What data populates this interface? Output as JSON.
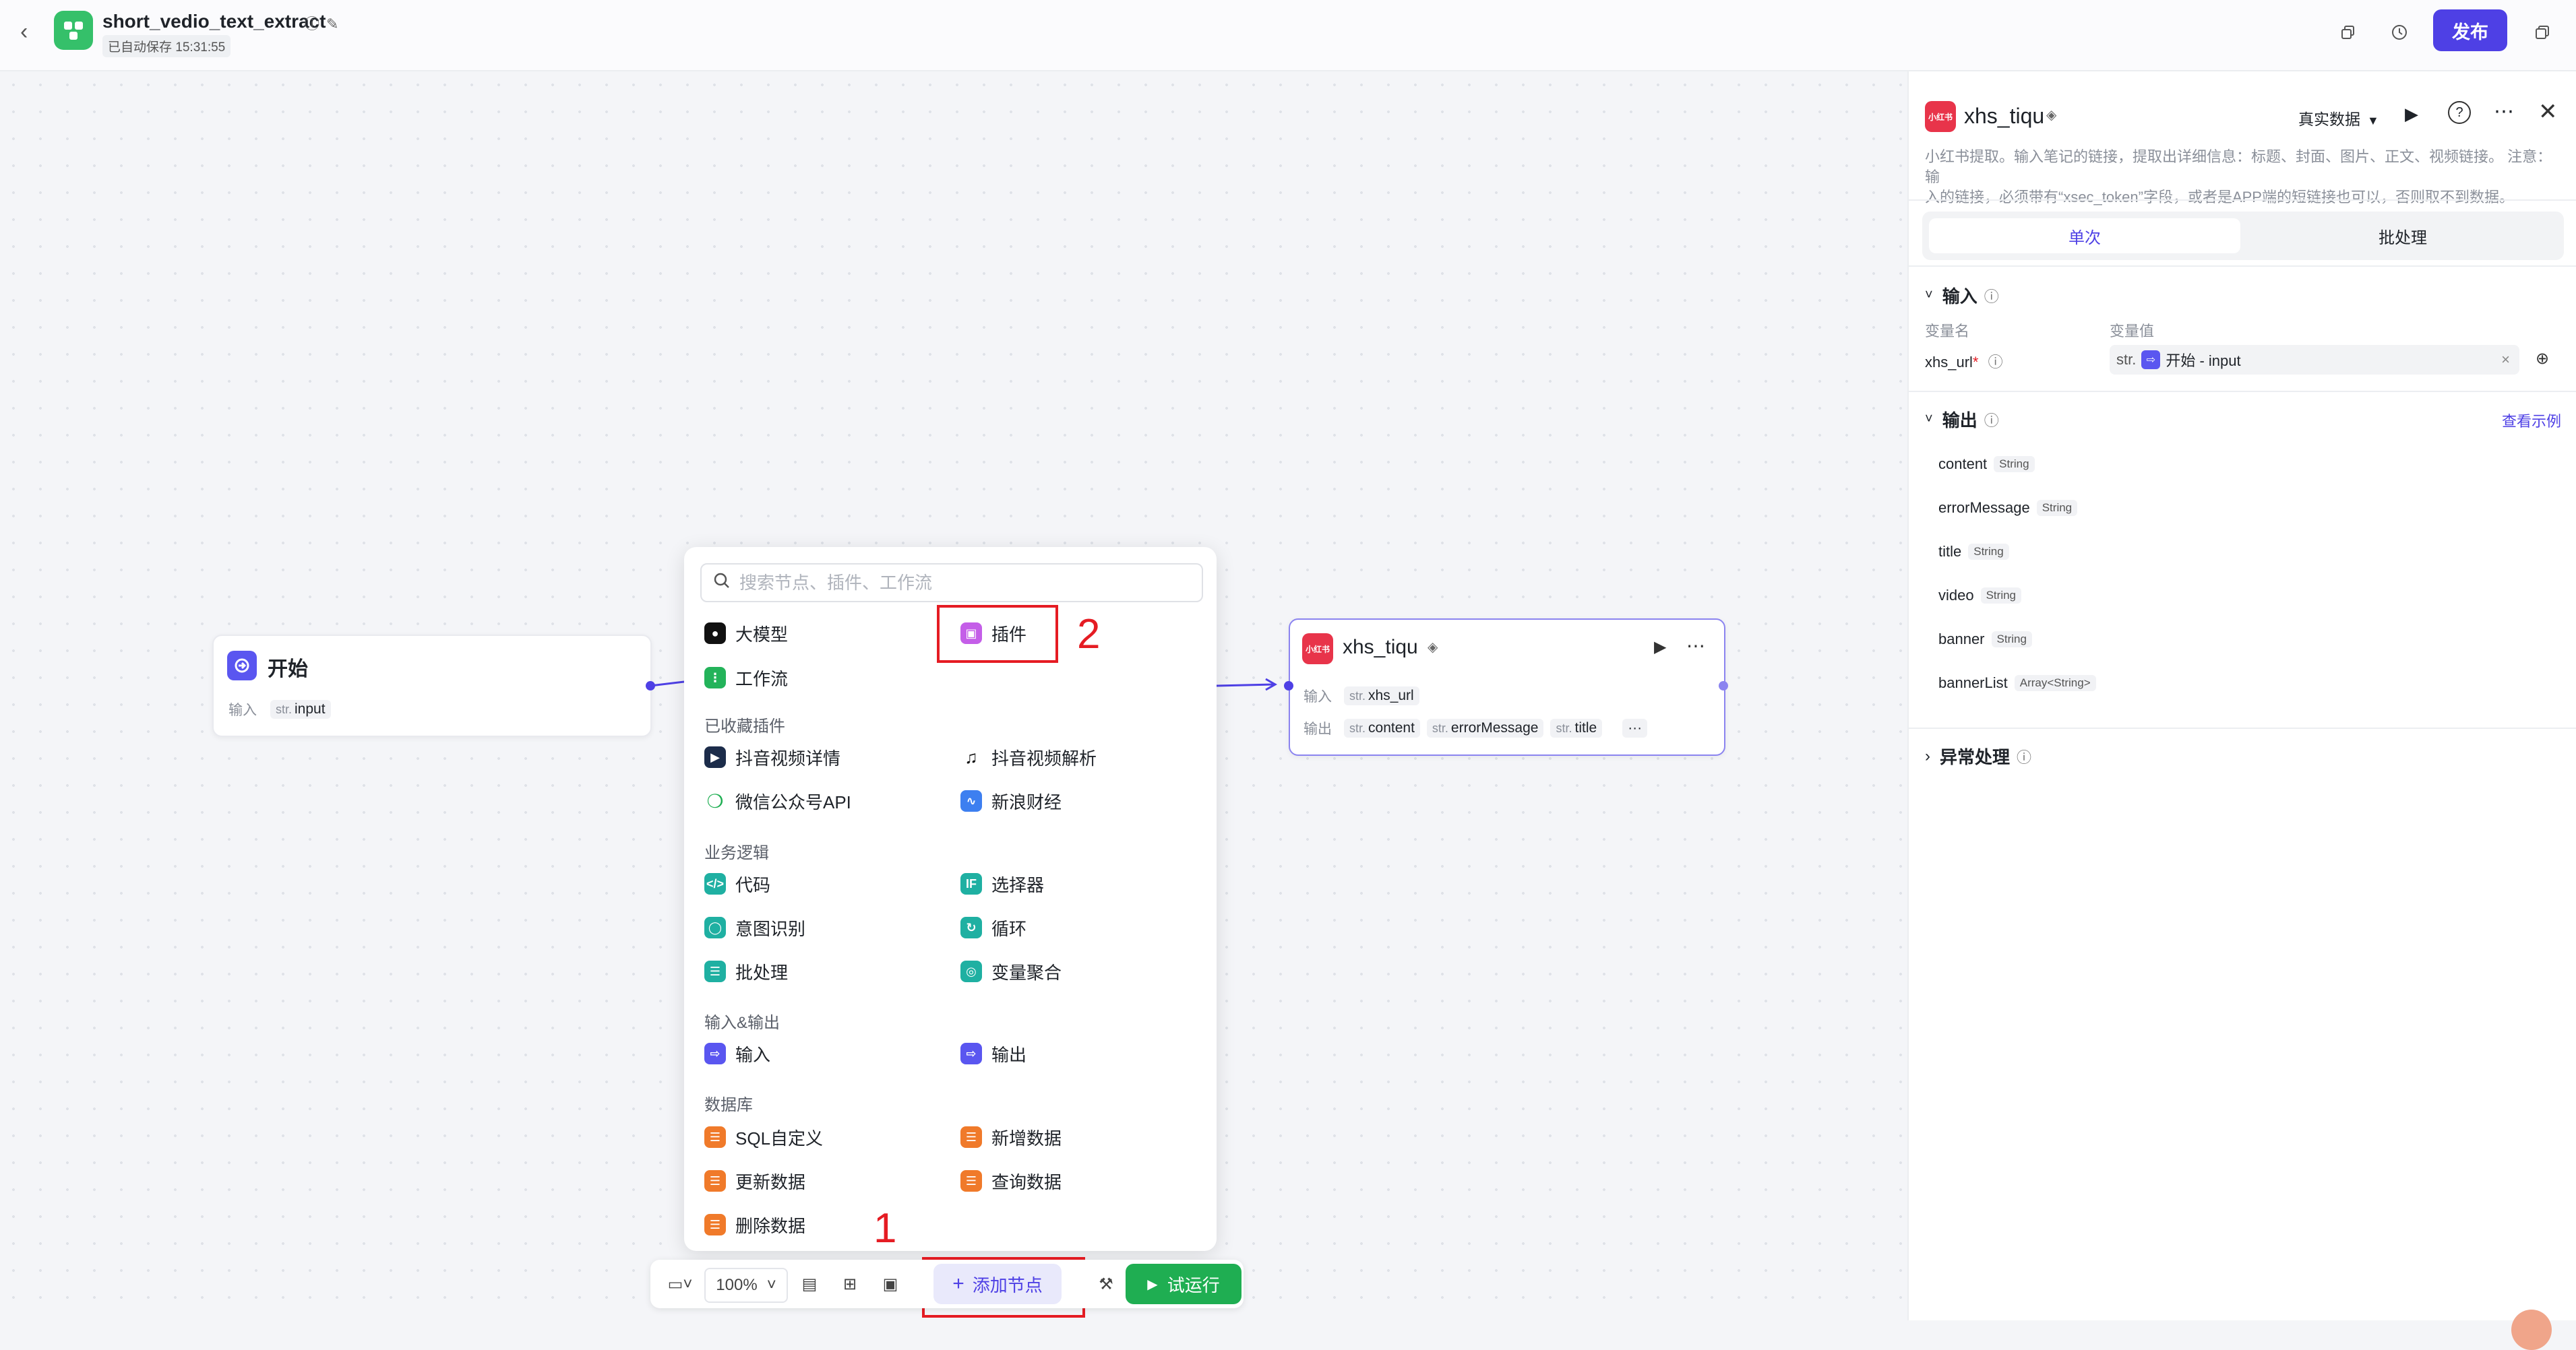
{
  "header": {
    "app_title": "short_vedio_text_extract",
    "autosave": "已自动保存 15:31:55",
    "publish_label": "发布"
  },
  "nodes": {
    "start": {
      "title": "开始",
      "input_label": "输入",
      "input_type": "str.",
      "input_name": "input"
    },
    "xhs": {
      "title": "xhs_tiqu",
      "logo_text": "小红书",
      "input_label": "输入",
      "input_type": "str.",
      "input_name": "xhs_url",
      "output_label": "输出",
      "outputs": [
        {
          "type": "str.",
          "name": "content"
        },
        {
          "type": "str.",
          "name": "errorMessage"
        },
        {
          "type": "str.",
          "name": "title"
        }
      ],
      "more": "···"
    }
  },
  "popup": {
    "search_placeholder": "搜索节点、插件、工作流",
    "top": [
      {
        "label": "大模型",
        "icon": "llm-icon"
      },
      {
        "label": "插件",
        "icon": "plugin-icon"
      },
      {
        "label": "工作流",
        "icon": "workflow-icon"
      }
    ],
    "sections": {
      "fav": "已收藏插件",
      "logic": "业务逻辑",
      "io": "输入&输出",
      "db": "数据库"
    },
    "fav_items": [
      "抖音视频详情",
      "抖音视频解析",
      "微信公众号API",
      "新浪财经"
    ],
    "logic_items": [
      "代码",
      "选择器",
      "意图识别",
      "循环",
      "批处理",
      "变量聚合"
    ],
    "io_items": [
      "输入",
      "输出"
    ],
    "db_items": [
      "SQL自定义",
      "新增数据",
      "更新数据",
      "查询数据",
      "删除数据"
    ]
  },
  "annotations": {
    "one": "1",
    "two": "2"
  },
  "toolbar": {
    "zoom": "100%",
    "add_node": "添加节点",
    "run": "试运行"
  },
  "panel": {
    "title": "xhs_tiqu",
    "logo_text": "小红书",
    "data_mode": "真实数据",
    "description_line1": "小红书提取。输入笔记的链接，提取出详细信息：标题、封面、图片、正文、视频链接。 注意：输",
    "description_line2": "入的链接，必须带有“xsec_token”字段，或者是APP端的短链接也可以，否则取不到数据。",
    "tab_single": "单次",
    "tab_batch": "批处理",
    "input_section": "输入",
    "col_var_name": "变量名",
    "col_var_value": "变量值",
    "input_var": "xhs_url",
    "required_mark": "*",
    "input_type": "str.",
    "input_ref": "开始 - input",
    "output_section": "输出",
    "view_example": "查看示例",
    "outputs": [
      {
        "name": "content",
        "type": "String"
      },
      {
        "name": "errorMessage",
        "type": "String"
      },
      {
        "name": "title",
        "type": "String"
      },
      {
        "name": "video",
        "type": "String"
      },
      {
        "name": "banner",
        "type": "String"
      },
      {
        "name": "bannerList",
        "type": "Array<String>"
      }
    ],
    "exception_section": "异常处理"
  },
  "colors": {
    "accent": "#4e40e5",
    "run": "#1fae52",
    "highlight": "#e51c23"
  }
}
